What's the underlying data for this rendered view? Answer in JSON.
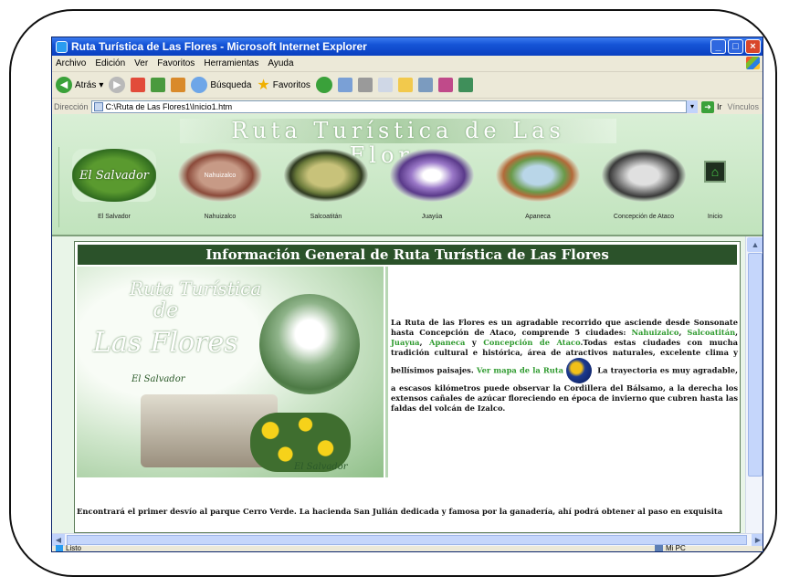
{
  "window": {
    "title": "Ruta Turística de Las Flores - Microsoft Internet Explorer",
    "buttons": {
      "minimize": "_",
      "maximize": "□",
      "close": "×"
    }
  },
  "menubar": [
    "Archivo",
    "Edición",
    "Ver",
    "Favoritos",
    "Herramientas",
    "Ayuda"
  ],
  "toolbar": {
    "back_label": "Atrás",
    "search_label": "Búsqueda",
    "favorites_label": "Favoritos"
  },
  "addressbar": {
    "label": "Dirección",
    "url": "C:\\Ruta de Las Flores1\\Inicio1.htm",
    "go_label": "Ir",
    "links_label": "Vínculos"
  },
  "page": {
    "banner": "Ruta Turística de Las Flores",
    "nav": [
      {
        "label": "El Salvador",
        "logo_text": "El Salvador"
      },
      {
        "label": "Nahuizalco",
        "logo_text": "Nahuizalco"
      },
      {
        "label": "Salcoatitán",
        "logo_text": ""
      },
      {
        "label": "Juayúa",
        "logo_text": ""
      },
      {
        "label": "Apaneca",
        "logo_text": ""
      },
      {
        "label": "Concepción de Ataco",
        "logo_text": ""
      }
    ],
    "home_label": "Inicio",
    "header": "Información General de Ruta Turística de Las Flores",
    "collage": {
      "line1": "Ruta Turística",
      "line2": "de",
      "line3": "Las Flores",
      "sub": "El Salvador",
      "sub2": "El Salvador"
    },
    "desc": {
      "intro": "La Ruta de las Flores es un agradable recorrido que asciende desde Sonsonate hasta Concepción de Ataco, comprende 5 ciudades: ",
      "city1": "Nahuizalco",
      "sep1": ", ",
      "city2": "Salcoatitán",
      "sep2": ", ",
      "city3": "Juayua",
      "sep3": ", ",
      "city4": "Apaneca",
      "sep4": " y ",
      "city5": "Concepción de Ataco",
      "rest": ".Todas estas ciudades con mucha tradición cultural e histórica, área de atractivos naturales, excelente clima y bellísimos paisajes. ",
      "map_link": "Ver mapa de la Ruta",
      "after_map": " La trayectoria es muy agradable, a escasos kilómetros puede observar la Cordillera del Bálsamo, a la derecha los extensos cañales de azúcar floreciendo en época de invierno que cubren hasta las faldas del volcán de Izalco."
    },
    "bottom_text": "Encontrará el primer desvío al parque Cerro Verde. La hacienda San Julián dedicada y famosa por la ganadería, ahí podrá obtener al paso en exquisita"
  },
  "status": {
    "left": "Listo",
    "right": "Mi PC"
  }
}
